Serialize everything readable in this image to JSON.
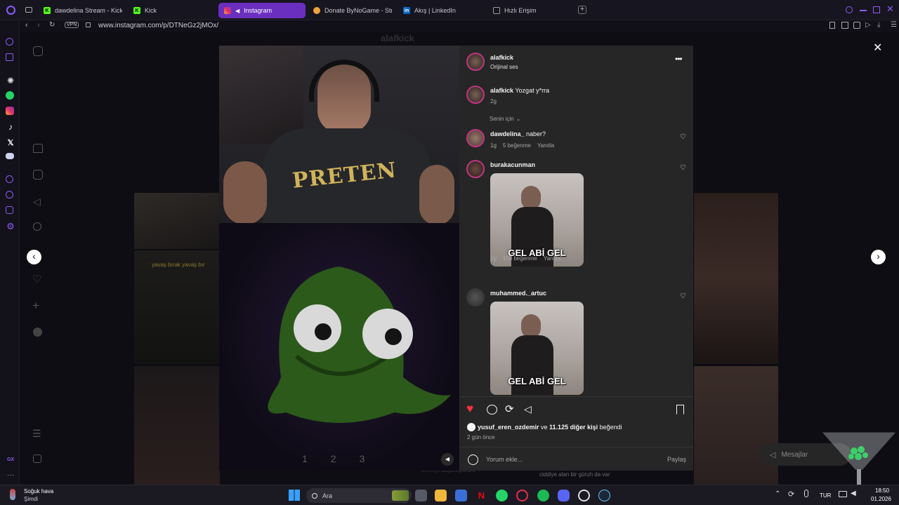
{
  "browser": {
    "tabs": [
      {
        "label": "dawdelina Stream - Kick D",
        "icon": "kick-icon",
        "color": "#53fc18",
        "active": false
      },
      {
        "label": "Kick",
        "icon": "kick-icon",
        "color": "#53fc18",
        "active": false
      },
      {
        "label": "Instagram",
        "icon": "instagram-icon",
        "color": "#e1306c",
        "active": true
      },
      {
        "label": "Donate ByNoGame - Strea",
        "icon": "donate-icon",
        "color": "#f2a33a",
        "active": false
      },
      {
        "label": "Akış | LinkedIn",
        "icon": "linkedin-icon",
        "color": "#0a66c2",
        "active": false
      },
      {
        "label": "Hızlı Erişim",
        "icon": "grid-icon",
        "color": "#888888",
        "active": false
      }
    ],
    "vpn_label": "VPN",
    "url": "www.instagram.com/p/DTNeGz2jMOx/"
  },
  "page": {
    "header_username": "alafkick",
    "video_counter": [
      "1",
      "2",
      "3"
    ],
    "thumb_caption_left": "yavaş bırak yavaş bır",
    "bottom_caption_1": "ciddiye alan bir güruh da var",
    "bottom_caption_2": "verneyi düşünüyorum"
  },
  "post": {
    "author": "alafkick",
    "audio": "Orijinal ses",
    "caption_user": "alafkick",
    "caption_text": "Yozgat y*rra",
    "caption_time": "2g",
    "sort_label": "Senin için",
    "comments": [
      {
        "user": "dawdelina_",
        "text": "naber?",
        "time": "1g",
        "likes": "5 beğenme",
        "reply": "Yanıtla",
        "has_image": false
      },
      {
        "user": "burakacunman",
        "text": "",
        "time": "1g",
        "likes": "158 beğenme",
        "reply": "Yanıtla",
        "has_image": true,
        "image_caption": "GEL ABİ GEL"
      },
      {
        "user": "muhammed._artuc",
        "text": "",
        "time": "",
        "likes": "",
        "reply": "",
        "has_image": true,
        "image_caption": "GEL ABİ GEL"
      }
    ],
    "liked_by_user": "yusuf_eren_ozdemir",
    "liked_by_mid": " ve ",
    "liked_by_others": "11.125 diğer kişi",
    "liked_by_suffix": " beğendi",
    "post_time": "2 gün önce",
    "comment_placeholder": "Yorum ekle...",
    "share_label": "Paylaş",
    "messages_label": "Mesajlar"
  },
  "taskbar": {
    "weather_title": "Soğuk hava",
    "weather_sub": "Şimdi",
    "search_label": "Ara",
    "language": "TUR",
    "time": "18:50",
    "date": "01.2026"
  },
  "colors": {
    "accent": "#6b2fbf",
    "like": "#ff3040",
    "panel": "#262626",
    "dim": "#a8a8a8"
  }
}
